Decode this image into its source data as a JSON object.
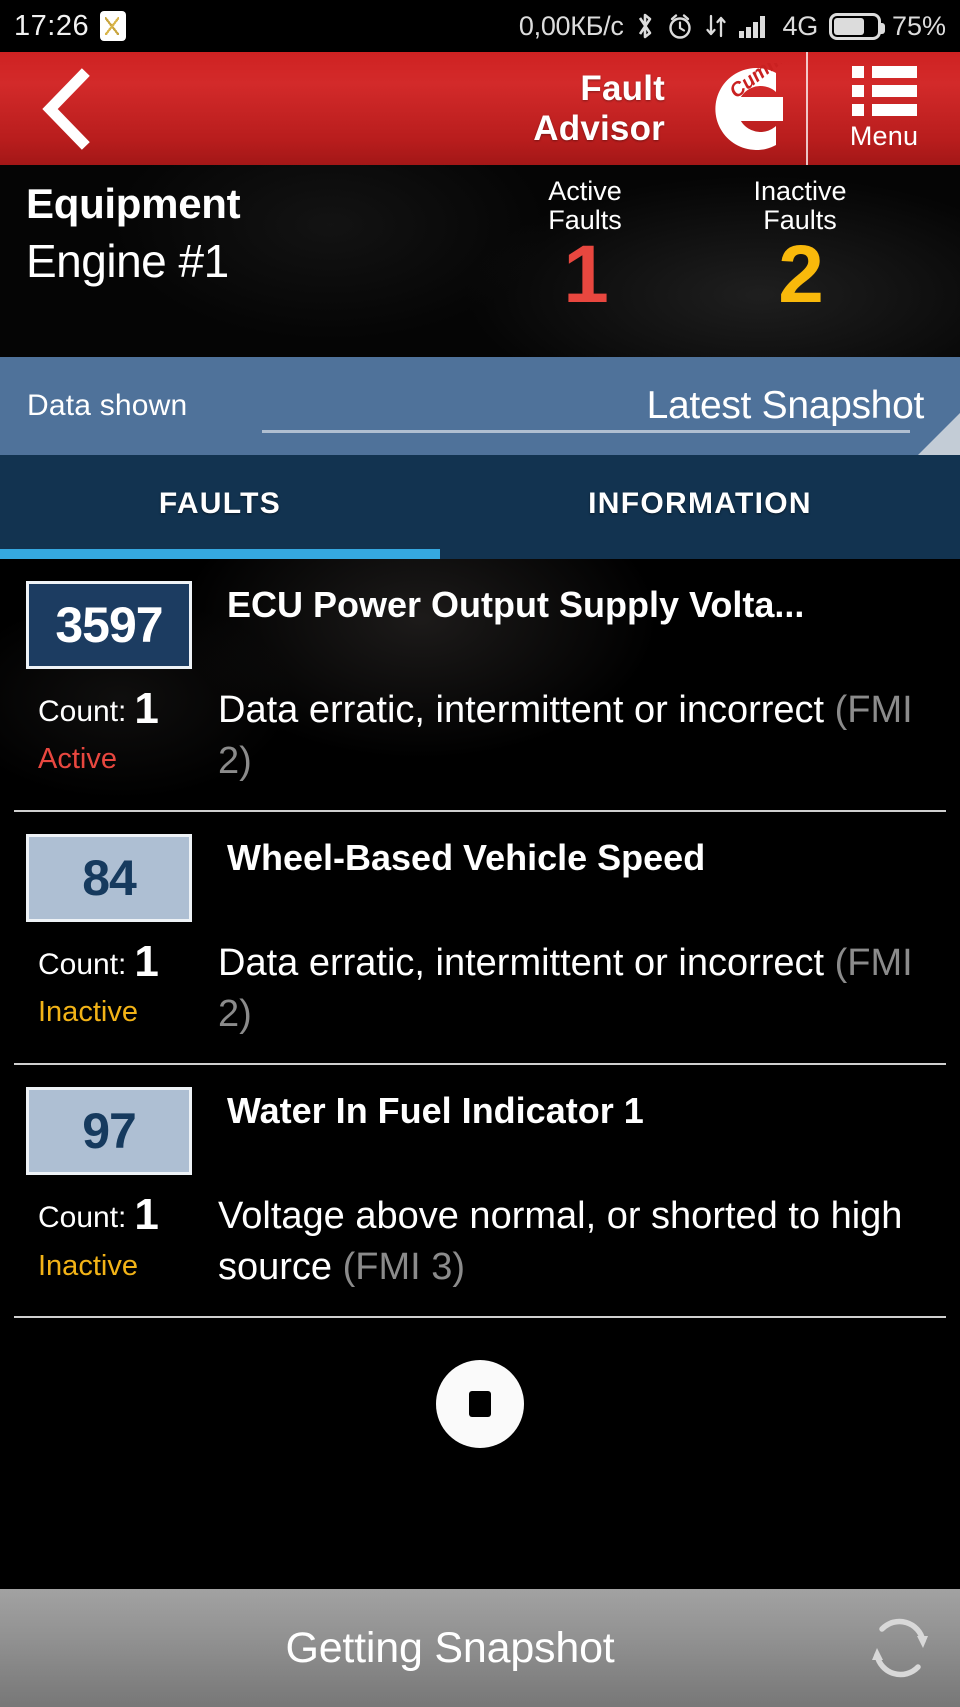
{
  "status_bar": {
    "time": "17:26",
    "app_icon": "app-notification-icon",
    "net_speed": "0,00КБ/с",
    "bluetooth_icon": "bluetooth-icon",
    "alarm_icon": "alarm-clock-icon",
    "data_transfer_icon": "data-transfer-icon",
    "signal_icon": "signal-bars-icon",
    "network": "4G",
    "battery_icon": "battery-icon",
    "battery_pct": "75%"
  },
  "header": {
    "back_icon": "back-chevron-icon",
    "title_line1": "Fault",
    "title_line2": "Advisor",
    "brand_logo": "cummins-logo",
    "brand_text": "Cummins",
    "menu_icon": "list-menu-icon",
    "menu_label": "Menu",
    "bg_color": "#c92020"
  },
  "equipment": {
    "heading": "Equipment",
    "name": "Engine #1",
    "active": {
      "label_line1": "Active",
      "label_line2": "Faults",
      "count": "1",
      "color": "#e8473f"
    },
    "inactive": {
      "label_line1": "Inactive",
      "label_line2": "Faults",
      "count": "2",
      "color": "#f9b90b"
    }
  },
  "data_shown": {
    "label": "Data shown",
    "value": "Latest Snapshot",
    "bg_color": "#4f729a",
    "corner_icon": "resize-corner-icon"
  },
  "tabs": {
    "items": [
      {
        "label": "FAULTS",
        "selected": true
      },
      {
        "label": "INFORMATION",
        "selected": false
      }
    ],
    "indicator_color": "#35a8e0",
    "bg_color": "#123350"
  },
  "faults": [
    {
      "spn": "3597",
      "title": "ECU Power Output Supply Volta...",
      "count_label": "Count:",
      "count": "1",
      "status": "Active",
      "description": "Data erratic, intermittent or incorrect",
      "fmi": "(FMI 2)",
      "state": "active"
    },
    {
      "spn": "84",
      "title": "Wheel-Based Vehicle Speed",
      "count_label": "Count:",
      "count": "1",
      "status": "Inactive",
      "description": "Data erratic, intermittent or incorrect",
      "fmi": "(FMI 2)",
      "state": "inactive"
    },
    {
      "spn": "97",
      "title": "Water In Fuel Indicator 1",
      "count_label": "Count:",
      "count": "1",
      "status": "Inactive",
      "description": "Voltage above normal, or shorted to high source",
      "fmi": "(FMI 3)",
      "state": "inactive"
    }
  ],
  "loading": {
    "spinner_icon": "loading-spinner-icon"
  },
  "bottom_bar": {
    "text": "Getting Snapshot",
    "refresh_icon": "refresh-sync-icon"
  }
}
